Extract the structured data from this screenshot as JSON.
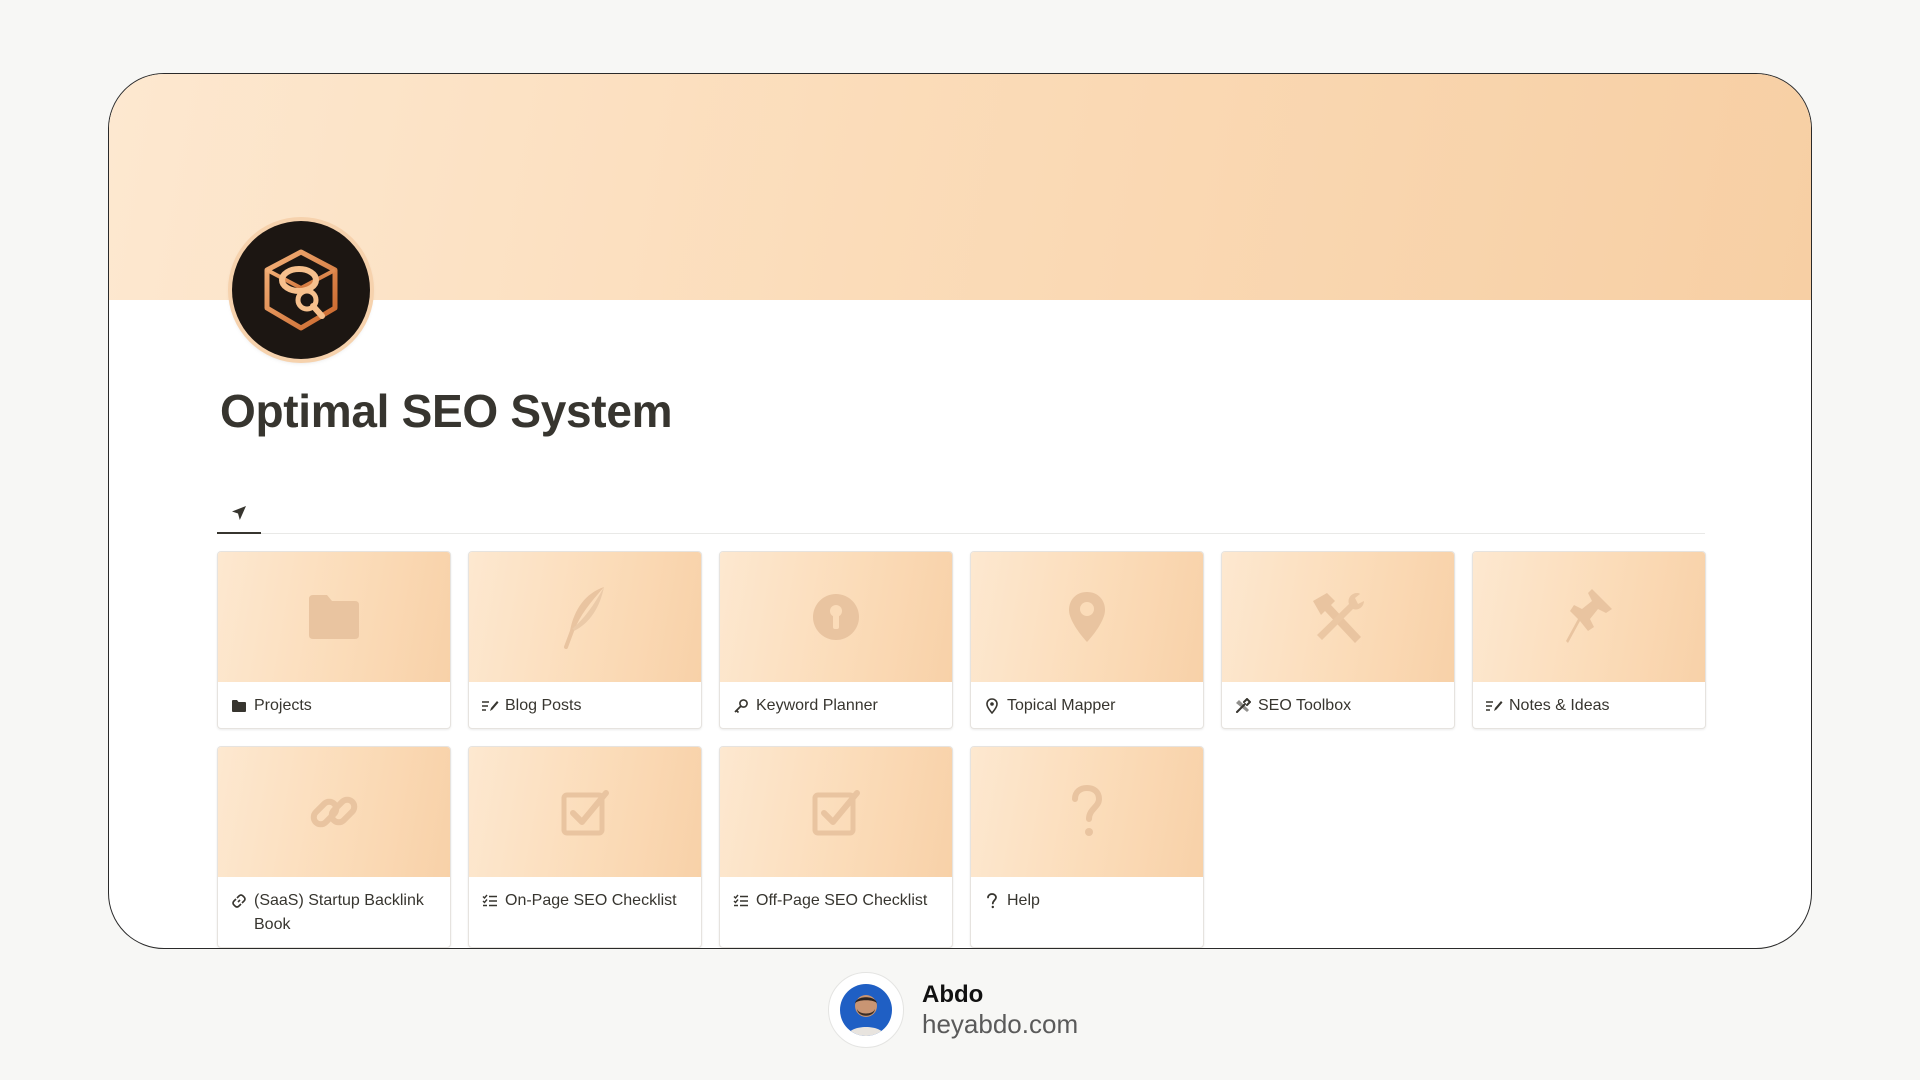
{
  "page": {
    "title": "Optimal SEO System",
    "cover_colors": [
      "#fde8d0",
      "#f7cfa4"
    ],
    "icon": "seo-cube-magnifier-icon"
  },
  "tabs": [
    {
      "icon": "navigation-arrow-icon",
      "label": ""
    }
  ],
  "cards": [
    {
      "label": "Projects",
      "icon": "folder-icon",
      "cover_icon": "folder-icon"
    },
    {
      "label": "Blog Posts",
      "icon": "pen-lines-icon",
      "cover_icon": "quill-icon"
    },
    {
      "label": "Keyword Planner",
      "icon": "key-icon",
      "cover_icon": "keyhole-icon"
    },
    {
      "label": "Topical Mapper",
      "icon": "map-pin-icon",
      "cover_icon": "map-pin-icon"
    },
    {
      "label": "SEO Toolbox",
      "icon": "tools-icon",
      "cover_icon": "hammer-wrench-icon"
    },
    {
      "label": "Notes & Ideas",
      "icon": "pen-lines-icon",
      "cover_icon": "pushpin-icon"
    },
    {
      "label": "(SaaS) Startup Backlink Book",
      "icon": "link-icon",
      "cover_icon": "link-icon"
    },
    {
      "label": "On-Page SEO Checklist",
      "icon": "checklist-icon",
      "cover_icon": "checkbox-icon"
    },
    {
      "label": "Off-Page SEO Checklist",
      "icon": "checklist-icon",
      "cover_icon": "checkbox-icon"
    },
    {
      "label": "Help",
      "icon": "question-icon",
      "cover_icon": "question-icon"
    }
  ],
  "author": {
    "name": "Abdo",
    "site": "heyabdo.com"
  },
  "colors": {
    "accent_orange": "#e08a4c",
    "cover_icon": "#e9c4a0",
    "text": "#37352f"
  }
}
